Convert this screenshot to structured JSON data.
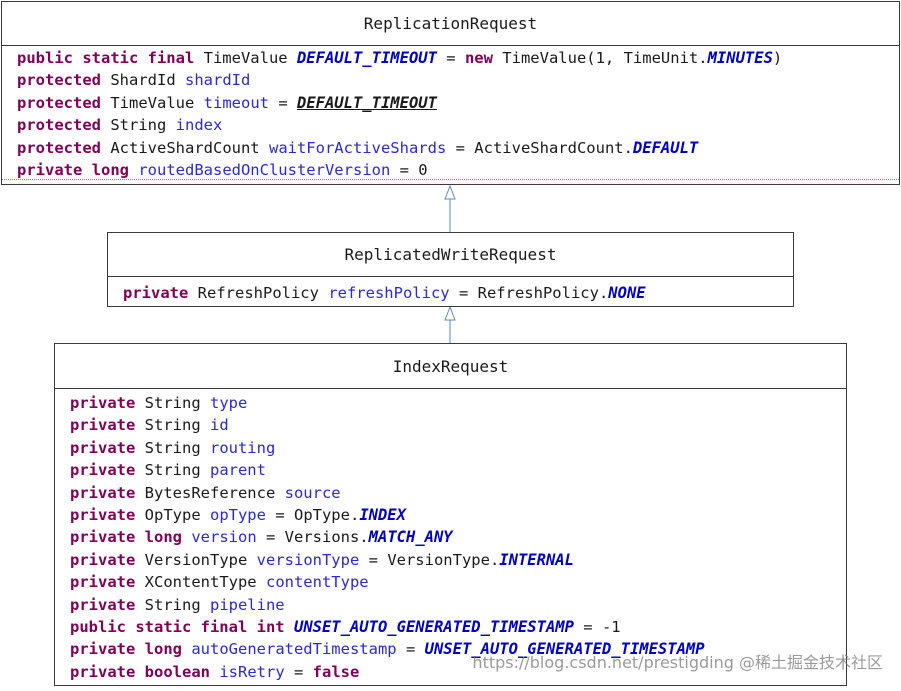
{
  "classes": [
    {
      "id": "replication-request",
      "name": "ReplicationRequest",
      "fields": [
        [
          {
            "t": "kw",
            "v": "public static final"
          },
          {
            "t": "typ",
            "v": " TimeValue "
          },
          {
            "t": "cst",
            "v": "DEFAULT_TIMEOUT"
          },
          {
            "t": "op",
            "v": " = "
          },
          {
            "t": "kw",
            "v": "new"
          },
          {
            "t": "val",
            "v": " TimeValue(1, TimeUnit."
          },
          {
            "t": "cst",
            "v": "MINUTES"
          },
          {
            "t": "val",
            "v": ")"
          }
        ],
        [
          {
            "t": "kw",
            "v": "protected"
          },
          {
            "t": "typ",
            "v": " ShardId "
          },
          {
            "t": "nm",
            "v": "shardId"
          }
        ],
        [
          {
            "t": "kw",
            "v": "protected"
          },
          {
            "t": "typ",
            "v": " TimeValue "
          },
          {
            "t": "nm",
            "v": "timeout"
          },
          {
            "t": "op",
            "v": " = "
          },
          {
            "t": "ul",
            "v": "DEFAULT_TIMEOUT"
          }
        ],
        [
          {
            "t": "kw",
            "v": "protected"
          },
          {
            "t": "typ",
            "v": " String "
          },
          {
            "t": "nm",
            "v": "index"
          }
        ],
        [
          {
            "t": "kw",
            "v": "protected"
          },
          {
            "t": "typ",
            "v": " ActiveShardCount "
          },
          {
            "t": "nm",
            "v": "waitForActiveShards"
          },
          {
            "t": "op",
            "v": " = "
          },
          {
            "t": "val",
            "v": "ActiveShardCount."
          },
          {
            "t": "cst",
            "v": "DEFAULT"
          }
        ],
        [
          {
            "t": "kw",
            "v": "private long"
          },
          {
            "t": "typ",
            "v": " "
          },
          {
            "t": "nm",
            "v": "routedBasedOnClusterVersion"
          },
          {
            "t": "op",
            "v": " = "
          },
          {
            "t": "val",
            "v": "0"
          }
        ]
      ]
    },
    {
      "id": "replicated-write-request",
      "name": "ReplicatedWriteRequest",
      "fields": [
        [
          {
            "t": "kw",
            "v": "private"
          },
          {
            "t": "typ",
            "v": " RefreshPolicy "
          },
          {
            "t": "nm",
            "v": "refreshPolicy"
          },
          {
            "t": "op",
            "v": " = "
          },
          {
            "t": "val",
            "v": "RefreshPolicy."
          },
          {
            "t": "cst",
            "v": "NONE"
          }
        ]
      ]
    },
    {
      "id": "index-request",
      "name": "IndexRequest",
      "fields": [
        [
          {
            "t": "kw",
            "v": "private"
          },
          {
            "t": "typ",
            "v": " String "
          },
          {
            "t": "nm",
            "v": "type"
          }
        ],
        [
          {
            "t": "kw",
            "v": "private"
          },
          {
            "t": "typ",
            "v": " String "
          },
          {
            "t": "nm",
            "v": "id"
          }
        ],
        [
          {
            "t": "kw",
            "v": "private"
          },
          {
            "t": "typ",
            "v": " String "
          },
          {
            "t": "nm",
            "v": "routing"
          }
        ],
        [
          {
            "t": "kw",
            "v": "private"
          },
          {
            "t": "typ",
            "v": " String "
          },
          {
            "t": "nm",
            "v": "parent"
          }
        ],
        [
          {
            "t": "kw",
            "v": "private"
          },
          {
            "t": "typ",
            "v": " BytesReference "
          },
          {
            "t": "nm",
            "v": "source"
          }
        ],
        [
          {
            "t": "kw",
            "v": "private"
          },
          {
            "t": "typ",
            "v": " OpType "
          },
          {
            "t": "nm",
            "v": "opType"
          },
          {
            "t": "op",
            "v": " = "
          },
          {
            "t": "val",
            "v": "OpType."
          },
          {
            "t": "cst",
            "v": "INDEX"
          }
        ],
        [
          {
            "t": "kw",
            "v": "private long"
          },
          {
            "t": "typ",
            "v": " "
          },
          {
            "t": "nm",
            "v": "version"
          },
          {
            "t": "op",
            "v": " = "
          },
          {
            "t": "val",
            "v": "Versions."
          },
          {
            "t": "cst",
            "v": "MATCH_ANY"
          }
        ],
        [
          {
            "t": "kw",
            "v": "private"
          },
          {
            "t": "typ",
            "v": " VersionType "
          },
          {
            "t": "nm",
            "v": "versionType"
          },
          {
            "t": "op",
            "v": " = "
          },
          {
            "t": "val",
            "v": "VersionType."
          },
          {
            "t": "cst",
            "v": "INTERNAL"
          }
        ],
        [
          {
            "t": "kw",
            "v": "private"
          },
          {
            "t": "typ",
            "v": " XContentType "
          },
          {
            "t": "nm",
            "v": "contentType"
          }
        ],
        [
          {
            "t": "kw",
            "v": "private"
          },
          {
            "t": "typ",
            "v": " String "
          },
          {
            "t": "nm",
            "v": "pipeline"
          }
        ],
        [
          {
            "t": "kw",
            "v": "public static final int"
          },
          {
            "t": "typ",
            "v": " "
          },
          {
            "t": "cst",
            "v": "UNSET_AUTO_GENERATED_TIMESTAMP"
          },
          {
            "t": "op",
            "v": " = "
          },
          {
            "t": "val",
            "v": "-1"
          }
        ],
        [
          {
            "t": "kw",
            "v": "private long"
          },
          {
            "t": "typ",
            "v": " "
          },
          {
            "t": "nm",
            "v": "autoGeneratedTimestamp"
          },
          {
            "t": "op",
            "v": " = "
          },
          {
            "t": "cst",
            "v": "UNSET_AUTO_GENERATED_TIMESTAMP"
          }
        ],
        [
          {
            "t": "kw",
            "v": "private boolean"
          },
          {
            "t": "typ",
            "v": " "
          },
          {
            "t": "nm",
            "v": "isRetry"
          },
          {
            "t": "op",
            "v": " = "
          },
          {
            "t": "kw",
            "v": "false"
          }
        ]
      ]
    }
  ],
  "inheritance": [
    {
      "child": "replicated-write-request",
      "parent": "replication-request"
    },
    {
      "child": "index-request",
      "parent": "replicated-write-request"
    }
  ],
  "colors": {
    "keyword": "#7f0055",
    "name": "#2a2ad0",
    "constant": "#0000c0",
    "arrow": "#5a8ab8",
    "border": "#3a3a3a"
  },
  "watermark": "https://blog.csdn.net/prestigding  @稀土掘金技术社区"
}
